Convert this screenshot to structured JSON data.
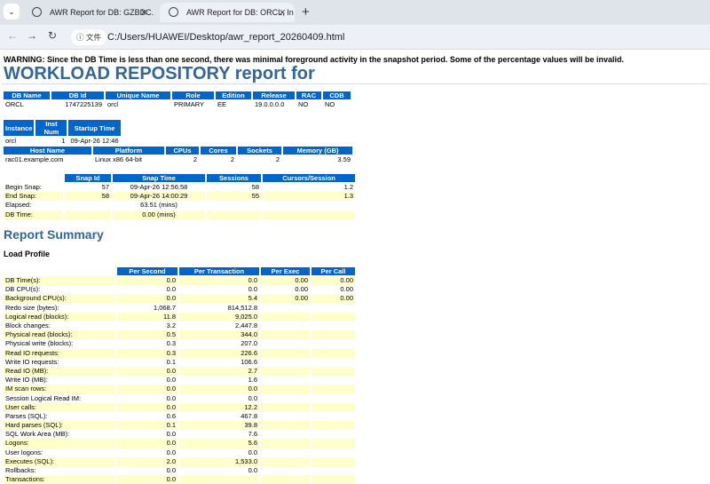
{
  "browser": {
    "tabs": [
      {
        "title": "AWR Report for DB: GZBDC.",
        "active": false
      },
      {
        "title": "AWR Report for DB: ORCL, In",
        "active": true
      }
    ],
    "chip_label": "文件",
    "url": "C:/Users/HUAWEI/Desktop/awr_report_20260409.html"
  },
  "page": {
    "warning": "WARNING: Since the DB Time is less than one second, there was minimal foreground activity in the snapshot period. Some of the percentage values will be invalid.",
    "title": "WORKLOAD REPOSITORY report for",
    "report_summary": "Report Summary",
    "load_profile": "Load Profile"
  },
  "colors": {
    "header_bg": "#0066cc",
    "title": "#336699",
    "alt_row": "#ffffcc"
  },
  "tables": {
    "db": {
      "headers": [
        "DB Name",
        "DB Id",
        "Unique Name",
        "Role",
        "Edition",
        "Release",
        "RAC",
        "CDB"
      ],
      "widths": [
        52,
        59,
        73,
        47,
        40,
        47,
        28,
        31
      ],
      "align": [
        "l",
        "r",
        "l",
        "l",
        "l",
        "l",
        "l",
        "l"
      ],
      "rows": [
        [
          "ORCL",
          "1747225139",
          "orcl",
          "PRIMARY",
          "EE",
          "19.0.0.0.0",
          "NO",
          "NO"
        ]
      ]
    },
    "instance": {
      "headers": [
        "Instance",
        "Inst Num",
        "Startup Time"
      ],
      "widths": [
        34,
        35,
        52
      ],
      "align": [
        "l",
        "r",
        "l"
      ],
      "rows": [
        [
          "orcl",
          "1",
          "09-Apr-26 12:46"
        ]
      ]
    },
    "host": {
      "headers": [
        "Host Name",
        "Platform",
        "CPUs",
        "Cores",
        "Sockets",
        "Memory (GB)"
      ],
      "widths": [
        99,
        80,
        37,
        40,
        49,
        78
      ],
      "align": [
        "l",
        "l",
        "r",
        "r",
        "r",
        "r"
      ],
      "rows": [
        [
          "rac01.example.com",
          "Linux x86 64-bit",
          "2",
          "2",
          "2",
          "3.59"
        ]
      ]
    },
    "snap": {
      "headers": [
        "",
        "Snap Id",
        "Snap Time",
        "Sessions",
        "Cursors/Session"
      ],
      "widths": [
        67,
        52,
        104,
        61,
        104
      ],
      "align": [
        "l",
        "r",
        "c",
        "r",
        "r"
      ],
      "rows": [
        [
          "Begin Snap:",
          "57",
          "09-Apr-26 12:56:58",
          "58",
          "1.2"
        ],
        [
          "End Snap:",
          "58",
          "09-Apr-26 14:00:29",
          "55",
          "1.3"
        ],
        [
          "Elapsed:",
          "",
          "63.51 (mins)",
          "",
          ""
        ],
        [
          "DB Time:",
          "",
          "0.00 (mins)",
          "",
          ""
        ]
      ]
    },
    "load": {
      "headers": [
        "",
        "Per Second",
        "Per Transaction",
        "Per Exec",
        "Per Call"
      ],
      "widths": [
        126,
        68,
        90,
        55,
        49
      ],
      "align": [
        "l",
        "r",
        "r",
        "r",
        "r"
      ],
      "rows": [
        [
          "DB Time(s):",
          "0.0",
          "0.0",
          "0.00",
          "0.00"
        ],
        [
          "DB CPU(s):",
          "0.0",
          "0.0",
          "0.00",
          "0.00"
        ],
        [
          "Background CPU(s):",
          "0.0",
          "5.4",
          "0.00",
          "0.00"
        ],
        [
          "Redo size (bytes):",
          "1,068.7",
          "814,512.8",
          "",
          ""
        ],
        [
          "Logical read (blocks):",
          "11.8",
          "9,025.0",
          "",
          ""
        ],
        [
          "Block changes:",
          "3.2",
          "2,447.8",
          "",
          ""
        ],
        [
          "Physical read (blocks):",
          "0.5",
          "344.0",
          "",
          ""
        ],
        [
          "Physical write (blocks):",
          "0.3",
          "207.0",
          "",
          ""
        ],
        [
          "Read IO requests:",
          "0.3",
          "226.6",
          "",
          ""
        ],
        [
          "Write IO requests:",
          "0.1",
          "106.6",
          "",
          ""
        ],
        [
          "Read IO (MB):",
          "0.0",
          "2.7",
          "",
          ""
        ],
        [
          "Write IO (MB):",
          "0.0",
          "1.6",
          "",
          ""
        ],
        [
          "IM scan rows:",
          "0.0",
          "0.0",
          "",
          ""
        ],
        [
          "Session Logical Read IM:",
          "0.0",
          "0.0",
          "",
          ""
        ],
        [
          "User calls:",
          "0.0",
          "12.2",
          "",
          ""
        ],
        [
          "Parses (SQL):",
          "0.6",
          "467.8",
          "",
          ""
        ],
        [
          "Hard parses (SQL):",
          "0.1",
          "39.8",
          "",
          ""
        ],
        [
          "SQL Work Area (MB):",
          "0.0",
          "7.6",
          "",
          ""
        ],
        [
          "Logons:",
          "0.0",
          "5.6",
          "",
          ""
        ],
        [
          "User logons:",
          "0.0",
          "0.0",
          "",
          ""
        ],
        [
          "Executes (SQL):",
          "2.0",
          "1,533.0",
          "",
          ""
        ],
        [
          "Rollbacks:",
          "0.0",
          "0.0",
          "",
          ""
        ],
        [
          "Transactions:",
          "0.0",
          "",
          "",
          " "
        ]
      ]
    }
  }
}
